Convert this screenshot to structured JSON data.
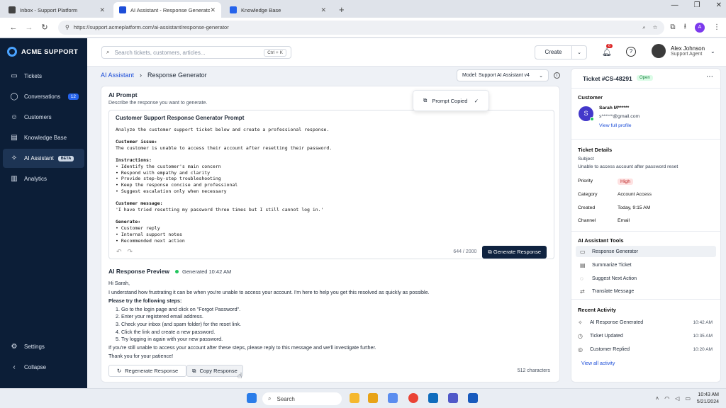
{
  "browser": {
    "tabs": [
      {
        "label": "Inbox - Support Platform",
        "color": "#444444"
      },
      {
        "label": "AI Assistant - Response Generator",
        "color": "#1d4ed8"
      },
      {
        "label": "Knowledge Base",
        "color": "#2563eb"
      }
    ],
    "url": "https://support.acmeplatform.com/ai-assistant/response-generator",
    "profile_initial": "A"
  },
  "sidebar": {
    "brand": "ACME SUPPORT",
    "items": [
      {
        "label": "Tickets",
        "icon": "tickets-icon"
      },
      {
        "label": "Conversations",
        "icon": "chat-icon",
        "badge": "12"
      },
      {
        "label": "Customers",
        "icon": "users-icon"
      },
      {
        "label": "Knowledge Base",
        "icon": "book-icon"
      },
      {
        "label": "AI Assistant",
        "icon": "sparkle-icon",
        "badge": "BETA",
        "active": true
      },
      {
        "label": "Analytics",
        "icon": "chart-icon"
      }
    ],
    "settings": "Settings",
    "collapse": "Collapse"
  },
  "header": {
    "search_placeholder": "Search tickets, customers, articles...",
    "search_shortcut": "Ctrl + K",
    "create": "Create",
    "notifications": "6",
    "user_name": "Alex Johnson",
    "user_role": "Support Agent"
  },
  "breadcrumb": {
    "parent": "AI Assistant",
    "current": "Response Generator"
  },
  "model": "Model: Support AI Assistant v4",
  "prompt": {
    "title": "AI Prompt",
    "subtitle": "Describe the response you want to generate.",
    "heading": "Customer Support Response Generator Prompt",
    "intro": "Analyze the customer support ticket below and create a professional response.",
    "issue_label": "Customer issue:",
    "issue": "The customer is unable to access their account after resetting their password.",
    "instructions_label": "Instructions:",
    "instructions": [
      "• Identify the customer's main concern",
      "• Respond with empathy and clarity",
      "• Provide step-by-step troubleshooting",
      "• Keep the response concise and professional",
      "• Suggest escalation only when necessary"
    ],
    "message_label": "Customer message:",
    "message": "'I have tried resetting my password three times but I still cannot log in.'",
    "generate_label": "Generate:",
    "generate_items": [
      "• Customer reply",
      "• Internal support notes",
      "• Recommended next action"
    ],
    "char_count": "644 / 2000",
    "generate_button": "Generate Response",
    "toast": "Prompt Copied"
  },
  "response": {
    "title": "AI Response Preview",
    "generated": "Generated 10:42 AM",
    "greeting": "Hi Sarah,",
    "line1": "I understand how frustrating it can be when you're unable to access your account. I'm here to help you get this resolved as quickly as possible.",
    "steps_label": "Please try the following steps:",
    "steps": [
      "Go to the login page and click on \"Forgot Password\".",
      "Enter your registered email address.",
      "Check your inbox (and spam folder) for the reset link.",
      "Click the link and create a new password.",
      "Try logging in again with your new password."
    ],
    "line2": "If you're still unable to access your account after these steps, please reply to this message and we'll investigate further.",
    "line3": "Thank you for your patience!",
    "regenerate": "Regenerate Response",
    "copy": "Copy Response",
    "chars": "512 characters"
  },
  "ticket": {
    "number": "Ticket #CS-48291",
    "status": "Open",
    "customer_heading": "Customer",
    "customer_initial": "S",
    "customer_name": "Sarah M******",
    "customer_email": "s******@gmail.com",
    "view_profile": "View full profile",
    "details_heading": "Ticket Details",
    "subject_label": "Subject",
    "subject": "Unable to access account after password reset",
    "fields": [
      {
        "label": "Priority",
        "value": "High"
      },
      {
        "label": "Category",
        "value": "Account Access"
      },
      {
        "label": "Created",
        "value": "Today, 9:15 AM"
      },
      {
        "label": "Channel",
        "value": "Email"
      }
    ],
    "tools_heading": "AI Assistant Tools",
    "tools": [
      "Response Generator",
      "Summarize Ticket",
      "Suggest Next Action",
      "Translate Message"
    ],
    "activity_heading": "Recent Activity",
    "activity": [
      {
        "label": "AI Response Generated",
        "time": "10:42 AM"
      },
      {
        "label": "Ticket Updated",
        "time": "10:35 AM"
      },
      {
        "label": "Customer Replied",
        "time": "10:20 AM"
      }
    ],
    "view_all": "View all activity"
  },
  "taskbar": {
    "search": "Search",
    "time": "10:43 AM",
    "date": "5/21/2024"
  }
}
